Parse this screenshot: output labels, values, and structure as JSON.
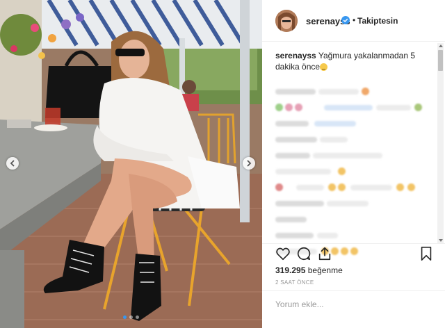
{
  "post": {
    "photo_alt": "Woman in white sweatshirt sitting at cafe table",
    "username": "serenayss",
    "verified": true,
    "follow_status": "Takiptesin",
    "caption_user": "serenayss",
    "caption_text": "Yağmura yakalanmadan 5 dakika önce",
    "likes_value": "319.295",
    "likes_label": "beğenme",
    "time_ago": "2 SAAT ÖNCE",
    "comment_placeholder": "Yorum ekle...",
    "carousel": {
      "count": 3,
      "active": 0
    },
    "icons": [
      "heart-icon",
      "comment-icon",
      "share-icon",
      "bookmark-icon",
      "chevron-left-icon",
      "chevron-right-icon",
      "verified-badge-icon"
    ]
  },
  "colors": {
    "verified": "#3897f0",
    "active_dot": "#3897f0",
    "text": "#262626",
    "muted": "#999999"
  }
}
